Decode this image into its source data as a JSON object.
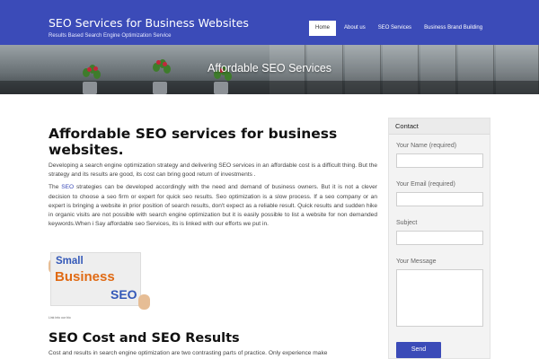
{
  "header": {
    "site_title": "SEO Services for Business Websites",
    "tagline": "Results Based Search Engine Optimization Service",
    "nav": [
      {
        "label": "Home",
        "active": true
      },
      {
        "label": "About us",
        "active": false
      },
      {
        "label": "SEO Services",
        "active": false
      },
      {
        "label": "Business Brand Building",
        "active": false
      }
    ]
  },
  "banner": {
    "title": "Affordable SEO Services"
  },
  "article": {
    "title": "Affordable SEO services for business websites.",
    "para1": "Developing a search engine optimization strategy and delivering SEO services in an affordable cost is a difficult thing. But the strategy and its results are good, its cost  can bring good return of investments .",
    "para2_before_link": "The ",
    "para2_link": "SEO",
    "para2_after_link": " strategies can be developed accordingly with the need and demand of business owners. But it is not a clever decision to choose a seo firm or expert for quick seo results. Seo optimization is a slow process. If a seo company or an expert is bringing a website in prior position of search results, don't expect as a reliable result. Quick results and sudden hike in organic visits are not possible with search engine optimization but it is easily possible to list a website for non demanded keywords.When i Say affordable seo Services, its is linked with our efforts we put in.",
    "promo_image": {
      "line1": "Small",
      "line2": "Business",
      "line3": "SEO",
      "caption": "Link into our bio"
    },
    "section_title": "SEO Cost and SEO Results",
    "section_para": "Cost and results in search engine optimization are two contrasting parts of practice. Only experience make"
  },
  "sidebar": {
    "widget_title": "Contact",
    "fields": {
      "name_label": "Your Name (required)",
      "email_label": "Your Email (required)",
      "subject_label": "Subject",
      "message_label": "Your Message"
    },
    "send_label": "Send"
  },
  "colors": {
    "brand": "#3b4bb8",
    "link": "#3b4bb8",
    "promo_blue": "#3358b8",
    "promo_orange": "#e06a14"
  }
}
